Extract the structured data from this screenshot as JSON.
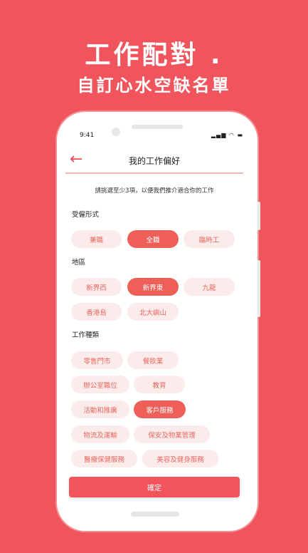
{
  "promo": {
    "title": "工作配對 .",
    "subtitle": "自訂心水空缺名單"
  },
  "status_bar": {
    "time": "9:41",
    "icons": [
      "signal-icon",
      "wifi-icon",
      "battery-icon"
    ]
  },
  "header": {
    "back_icon": "←",
    "title": "我的工作偏好"
  },
  "instruction": "請挑選至少3項，以便我們推介適合你的工作",
  "sections": {
    "employment": {
      "title": "受僱形式",
      "options": [
        {
          "label": "兼職",
          "selected": false
        },
        {
          "label": "全職",
          "selected": true
        },
        {
          "label": "臨時工",
          "selected": false
        }
      ]
    },
    "district": {
      "title": "地區",
      "options": [
        {
          "label": "新界西",
          "selected": false
        },
        {
          "label": "新界東",
          "selected": true
        },
        {
          "label": "九龍",
          "selected": false
        },
        {
          "label": "香港島",
          "selected": false
        },
        {
          "label": "北大嶼山",
          "selected": false
        }
      ]
    },
    "job_type": {
      "title": "工作種類",
      "options": [
        {
          "label": "零售門市",
          "selected": false
        },
        {
          "label": "餐飲業",
          "selected": false
        },
        {
          "label": "辦公室職位",
          "selected": false
        },
        {
          "label": "教育",
          "selected": false
        },
        {
          "label": "活動和推廣",
          "selected": false
        },
        {
          "label": "客戶服務",
          "selected": true
        },
        {
          "label": "物流及運輸",
          "selected": false
        },
        {
          "label": "保安及物業管理",
          "selected": false
        },
        {
          "label": "醫療保健服務",
          "selected": false
        },
        {
          "label": "美容及健身服務",
          "selected": false
        }
      ]
    }
  },
  "confirm_label": "確定",
  "colors": {
    "background": "#f0555d",
    "accent": "#ee5f58",
    "chip_bg": "#fbeceb",
    "chip_text": "#e86860"
  }
}
